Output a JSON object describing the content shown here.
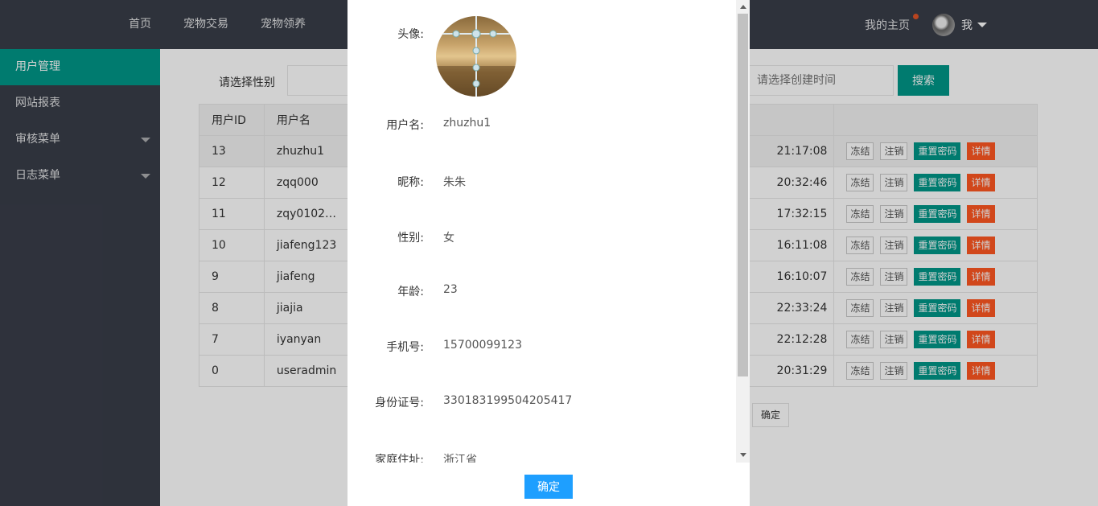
{
  "header": {
    "nav": [
      "首页",
      "宠物交易",
      "宠物领养"
    ],
    "homepage": "我的主页",
    "user": "我"
  },
  "sidebar": {
    "items": [
      {
        "label": "用户管理",
        "active": true
      },
      {
        "label": "网站报表"
      },
      {
        "label": "审核菜单",
        "has_caret": true
      },
      {
        "label": "日志菜单",
        "has_caret": true
      }
    ]
  },
  "search": {
    "gender_label": "请选择性别",
    "date_placeholder": "请选择创建时间",
    "search_button": "搜索"
  },
  "table": {
    "headers": [
      "用户ID",
      "用户名"
    ],
    "rows": [
      {
        "id": "13",
        "username": "zhuzhu1",
        "time": "21:17:08"
      },
      {
        "id": "12",
        "username": "zqq000",
        "time": "20:32:46"
      },
      {
        "id": "11",
        "username": "zqy0102…",
        "time": "17:32:15"
      },
      {
        "id": "10",
        "username": "jiafeng123",
        "time": "16:11:08"
      },
      {
        "id": "9",
        "username": "jiafeng",
        "time": "16:10:07"
      },
      {
        "id": "8",
        "username": "jiajia",
        "time": "22:33:24"
      },
      {
        "id": "7",
        "username": "iyanyan",
        "time": "22:12:28"
      },
      {
        "id": "0",
        "username": "useradmin",
        "time": "20:31:29"
      }
    ],
    "actions": {
      "freeze": "冻结",
      "cancel": "注销",
      "reset": "重置密码",
      "detail": "详情"
    }
  },
  "pagination": {
    "confirm": "确定"
  },
  "modal": {
    "avatar_label": "头像:",
    "fields": [
      {
        "label": "用户名:",
        "value": "zhuzhu1"
      },
      {
        "label": "昵称:",
        "value": "朱朱"
      },
      {
        "label": "性别:",
        "value": "女"
      },
      {
        "label": "年龄:",
        "value": "23"
      },
      {
        "label": "手机号:",
        "value": "15700099123"
      },
      {
        "label": "身份证号:",
        "value": "330183199504205417"
      },
      {
        "label": "家庭住址:",
        "value": "浙江省"
      }
    ],
    "ok_button": "确定"
  },
  "colors": {
    "header_bg": "#393d49",
    "accent": "#009688",
    "danger": "#ff5722",
    "primary": "#1e9fff"
  }
}
